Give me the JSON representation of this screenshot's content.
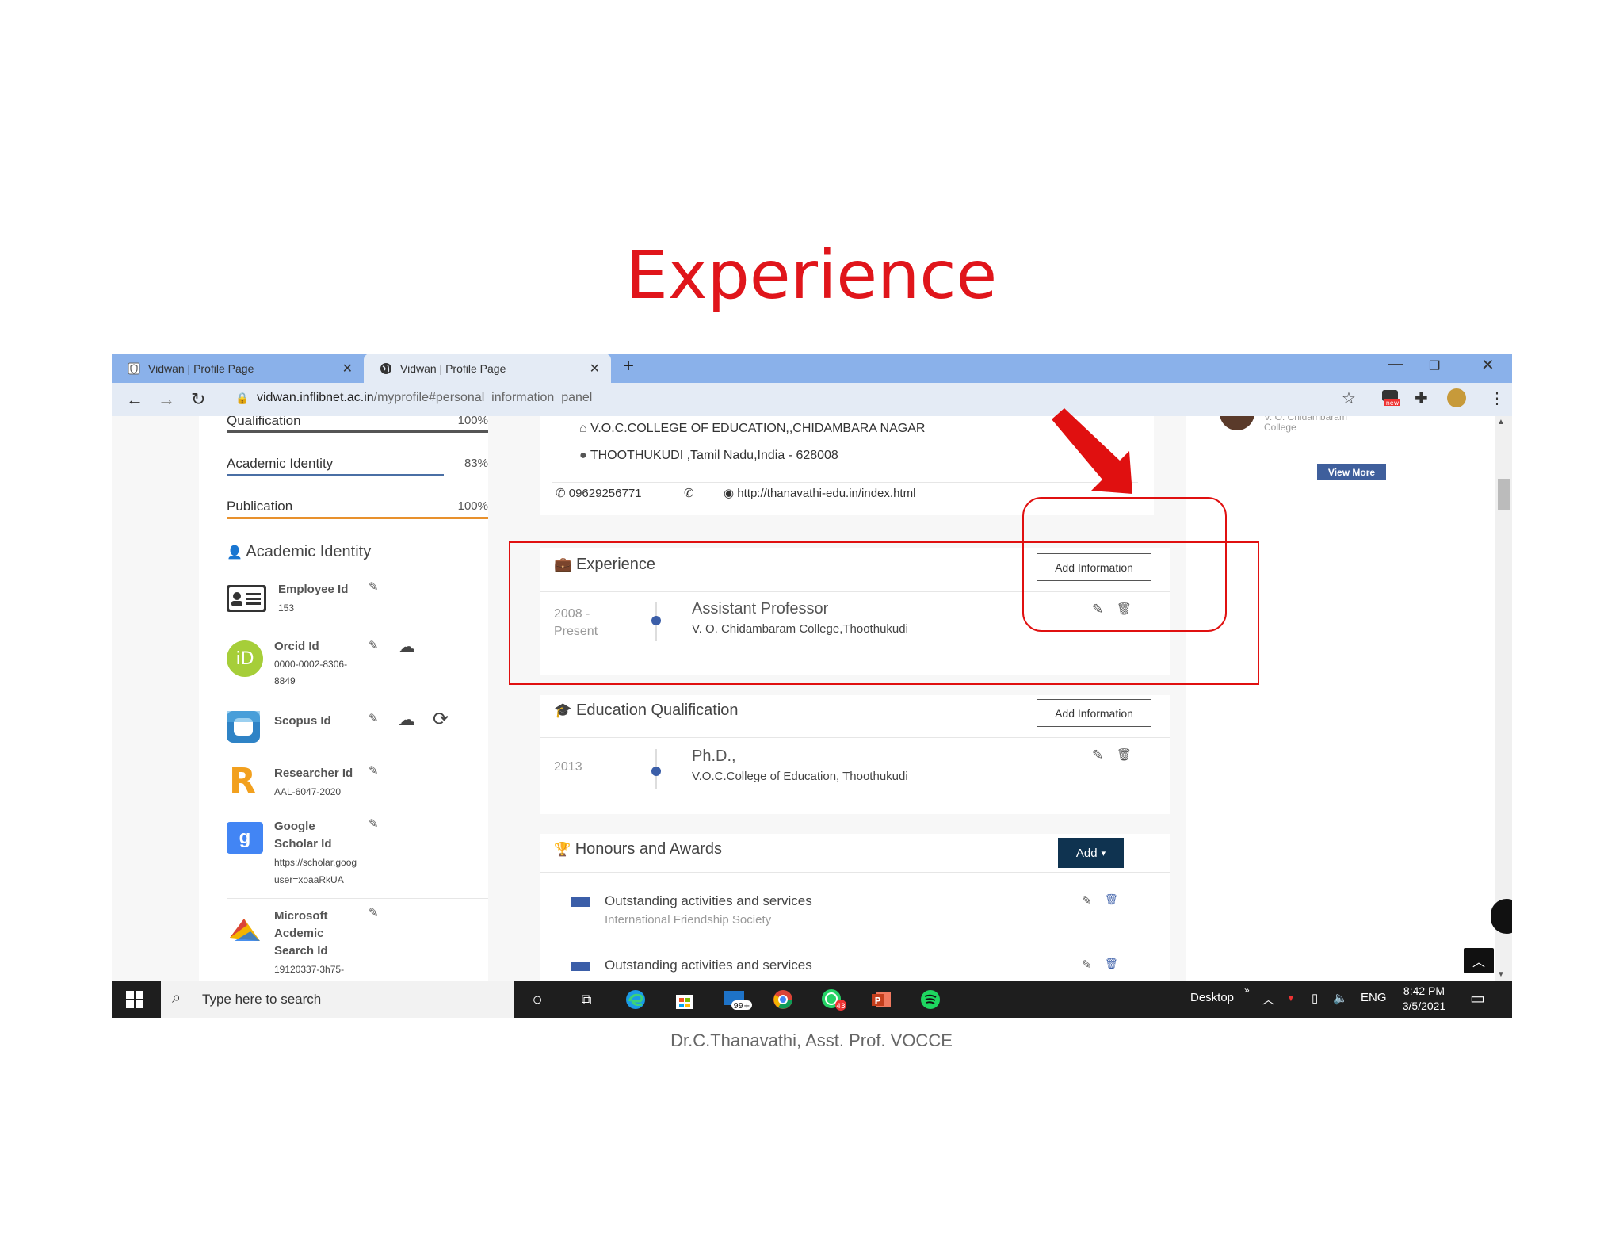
{
  "slide": {
    "title": "Experience",
    "footer": "Dr.C.Thanavathi, Asst. Prof. VOCCE"
  },
  "browser": {
    "tabs": [
      {
        "title": "Vidwan | Profile Page",
        "icon": "shield-icon"
      },
      {
        "title": "Vidwan | Profile Page",
        "icon": "globe-icon"
      }
    ],
    "url_host": "vidwan.inflibnet.ac.in",
    "url_path": "/myprofile#personal_information_panel",
    "toolbar_badge": "new"
  },
  "sidebar": {
    "progress": [
      {
        "label": "Qualification",
        "value": "100%",
        "fraction": 1.0,
        "color": "#555555"
      },
      {
        "label": "Academic Identity",
        "value": "83%",
        "fraction": 0.83,
        "color": "#4a6fa5"
      },
      {
        "label": "Publication",
        "value": "100%",
        "fraction": 1.0,
        "color": "#e8912d"
      }
    ],
    "section_title": "Academic Identity",
    "identities": [
      {
        "name": "Employee Id",
        "value": "153"
      },
      {
        "name": "Orcid Id",
        "value_lines": [
          "0000-0002-8306-",
          "8849"
        ]
      },
      {
        "name": "Scopus Id"
      },
      {
        "name": "Researcher Id",
        "value": "AAL-6047-2020"
      },
      {
        "name_lines": [
          "Google",
          "Scholar Id"
        ],
        "value_lines": [
          "https://scholar.goog",
          "user=xoaaRkUA"
        ]
      },
      {
        "name_lines": [
          "Microsoft",
          "Acdemic",
          "Search Id"
        ],
        "value": "19120337-3h75-"
      }
    ]
  },
  "contact": {
    "college": "V.O.C.COLLEGE OF EDUCATION,,CHIDAMBARA NAGAR",
    "address": "THOOTHUKUDI ,Tamil Nadu,India - 628008",
    "phone": "09629256771",
    "website": "http://thanavathi-edu.in/index.html"
  },
  "experience": {
    "heading": "Experience",
    "add_label": "Add Information",
    "date_lines": [
      "2008 -",
      "Present"
    ],
    "role": "Assistant Professor",
    "org": "V. O. Chidambaram College,Thoothukudi"
  },
  "education": {
    "heading": "Education Qualification",
    "add_label": "Add Information",
    "year": "2013",
    "degree": "Ph.D.,",
    "org": "V.O.C.College of Education, Thoothukudi"
  },
  "honours": {
    "heading": "Honours and Awards",
    "add_label": "Add",
    "items": [
      {
        "title": "Outstanding activities and services",
        "org": "International Friendship Society"
      },
      {
        "title": "Outstanding activities and services"
      }
    ]
  },
  "right_panel": {
    "profile_lines": [
      "V. O. Chidambaram",
      "College"
    ],
    "view_more": "View More"
  },
  "taskbar": {
    "search_placeholder": "Type here to search",
    "mail_badge": "99+",
    "whatsapp_badge": "43",
    "desktop_label": "Desktop",
    "lang": "ENG",
    "time": "8:42 PM",
    "date": "3/5/2021"
  },
  "colors": {
    "title_red": "#e0151b",
    "highlight_red": "#e01010",
    "dark_navy": "#0f3350",
    "view_more_blue": "#3f5f9c",
    "chrome_tabbar": "#8ab1ea"
  }
}
